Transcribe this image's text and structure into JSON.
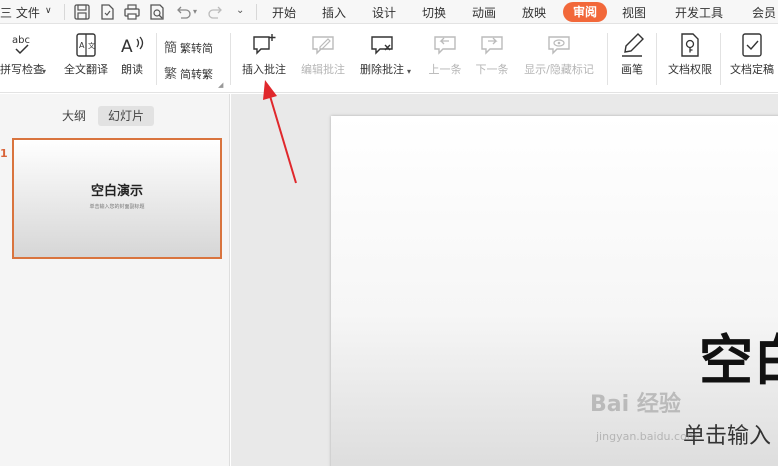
{
  "menubar": {
    "file_label": "三 文件",
    "tabs": [
      "开始",
      "插入",
      "设计",
      "切换",
      "动画",
      "放映",
      "审阅",
      "视图",
      "开发工具",
      "会员"
    ],
    "active_tab": "审阅"
  },
  "ribbon": {
    "spell_check": "拼写检查",
    "full_translate": "全文翻译",
    "read_aloud": "朗读",
    "trad_to_simp": "繁转简",
    "simp_to_trad": "简转繁",
    "insert_comment": "插入批注",
    "edit_comment": "编辑批注",
    "delete_comment": "删除批注",
    "prev_item": "上一条",
    "next_item": "下一条",
    "show_hide_marks": "显示/隐藏标记",
    "pen": "画笔",
    "doc_permission": "文档权限",
    "doc_finalize": "文档定稿"
  },
  "panel": {
    "tab_outline": "大纲",
    "tab_slides": "幻灯片",
    "slide_number": "1",
    "thumb_title": "空白演示",
    "thumb_subtitle": "单击输入您的封面副标题"
  },
  "slide": {
    "title_partial": "空白",
    "subtitle_partial": "单击输入"
  },
  "watermark": {
    "text": "Bai 经验",
    "url": "jingyan.baidu.com"
  },
  "colors": {
    "accent": "#f2683a",
    "selection_border": "#d9743e",
    "annotation_arrow": "#e0282c"
  }
}
